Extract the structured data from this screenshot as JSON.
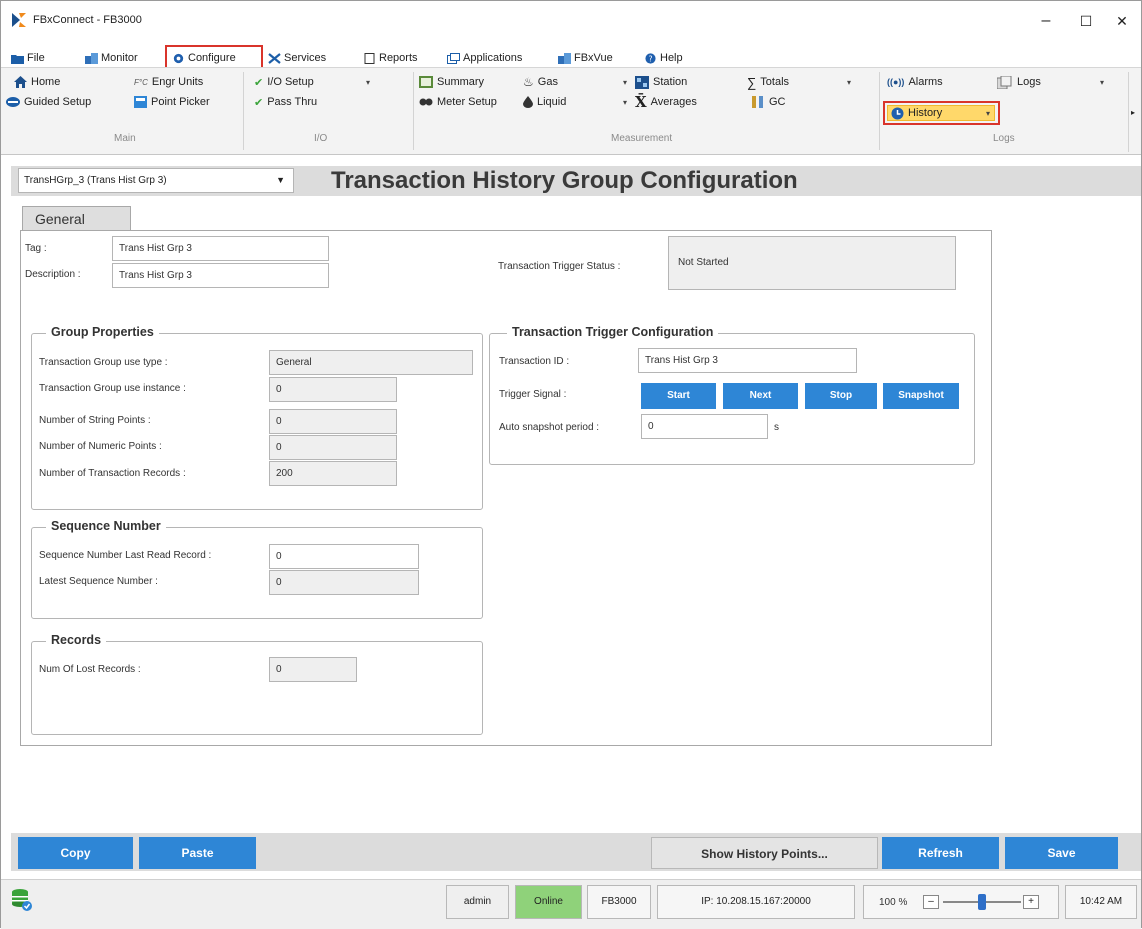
{
  "window": {
    "title": "FBxConnect - FB3000",
    "minimize": "–",
    "maximize": "☐",
    "close": "✕"
  },
  "menu": {
    "file": "File",
    "monitor": "Monitor",
    "configure": "Configure",
    "services": "Services",
    "reports": "Reports",
    "applications": "Applications",
    "fbxvue": "FBxVue",
    "help": "Help"
  },
  "ribbon": {
    "main": {
      "label": "Main",
      "home": "Home",
      "engr_units": "Engr Units",
      "guided_setup": "Guided Setup",
      "point_picker": "Point Picker"
    },
    "io": {
      "label": "I/O",
      "io_setup": "I/O Setup",
      "pass_thru": "Pass Thru"
    },
    "measurement": {
      "label": "Measurement",
      "summary": "Summary",
      "meter_setup": "Meter Setup",
      "gas": "Gas",
      "liquid": "Liquid",
      "station": "Station",
      "averages": "Averages",
      "totals": "Totals",
      "gc": "GC"
    },
    "logs": {
      "label": "Logs",
      "alarms": "Alarms",
      "history": "History",
      "logs": "Logs"
    }
  },
  "header": {
    "group_select": "TransHGrp_3 (Trans Hist Grp 3)",
    "title": "Transaction History Group Configuration"
  },
  "tabs": {
    "general": "General"
  },
  "form": {
    "tag_label": "Tag :",
    "tag_value": "Trans Hist Grp 3",
    "description_label": "Description :",
    "description_value": "Trans Hist Grp 3",
    "trigger_status_label": "Transaction Trigger Status :",
    "trigger_status_value": "Not Started"
  },
  "group_properties": {
    "title": "Group Properties",
    "use_type_label": "Transaction Group use type :",
    "use_type_value": "General",
    "use_instance_label": "Transaction Group use instance :",
    "use_instance_value": "0",
    "string_points_label": "Number of String Points :",
    "string_points_value": "0",
    "numeric_points_label": "Number of Numeric Points :",
    "numeric_points_value": "0",
    "records_label": "Number of Transaction Records :",
    "records_value": "200"
  },
  "trigger_config": {
    "title": "Transaction Trigger Configuration",
    "transaction_id_label": "Transaction ID :",
    "transaction_id_value": "Trans Hist Grp 3",
    "trigger_signal_label": "Trigger Signal :",
    "start": "Start",
    "next": "Next",
    "stop": "Stop",
    "snapshot": "Snapshot",
    "auto_snapshot_label": "Auto snapshot period :",
    "auto_snapshot_value": "0",
    "auto_snapshot_unit": "s"
  },
  "sequence_number": {
    "title": "Sequence Number",
    "last_read_label": "Sequence Number Last Read Record :",
    "last_read_value": "0",
    "latest_label": "Latest Sequence Number :",
    "latest_value": "0"
  },
  "records": {
    "title": "Records",
    "lost_label": "Num Of Lost Records :",
    "lost_value": "0"
  },
  "footer": {
    "copy": "Copy",
    "paste": "Paste",
    "show_history": "Show History Points...",
    "refresh": "Refresh",
    "save": "Save"
  },
  "status": {
    "user": "admin",
    "connection": "Online",
    "device": "FB3000",
    "ip": "IP: 10.208.15.167:20000",
    "zoom": "100 %",
    "zoom_minus": "–",
    "zoom_plus": "+",
    "zoom_level": 0.5,
    "time": "10:42 AM"
  },
  "colors": {
    "accent_blue": "#2e86d6",
    "highlight_red": "#d9342b",
    "online_green": "#8fd27a",
    "history_yellow": "#ffd86a"
  }
}
